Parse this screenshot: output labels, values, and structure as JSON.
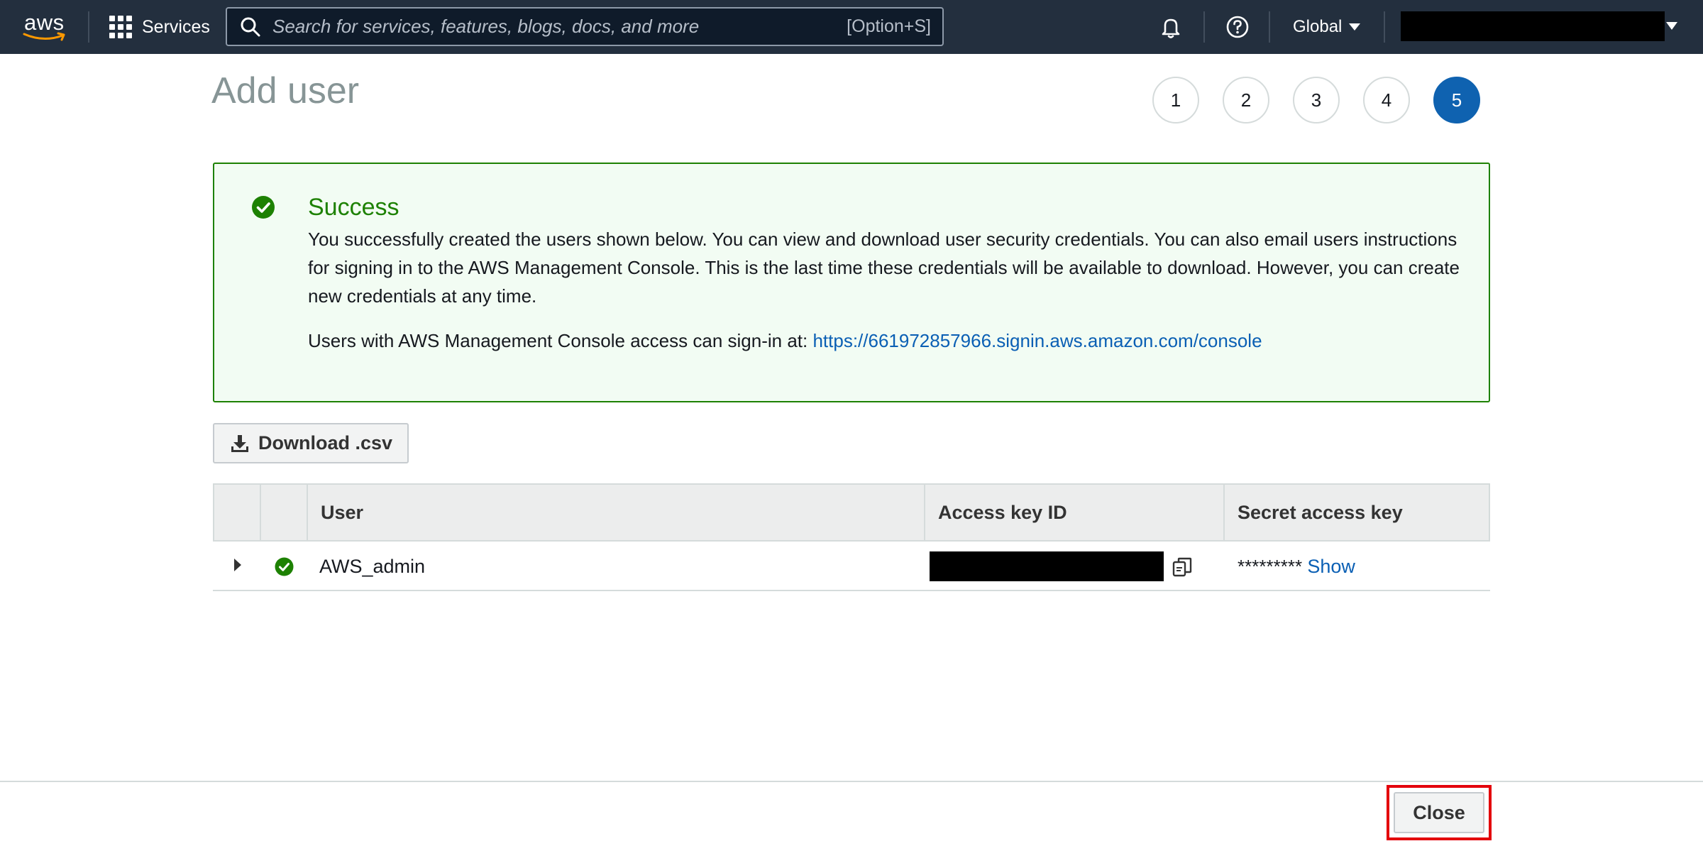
{
  "topnav": {
    "logo_text": "aws",
    "services_label": "Services",
    "search_placeholder": "Search for services, features, blogs, docs, and more",
    "search_shortcut": "[Option+S]",
    "region_label": "Global"
  },
  "page": {
    "title": "Add user",
    "steps": [
      "1",
      "2",
      "3",
      "4",
      "5"
    ],
    "active_step": "5"
  },
  "alert": {
    "title": "Success",
    "body": "You successfully created the users shown below. You can view and download user security credentials. You can also email users instructions for signing in to the AWS Management Console. This is the last time these credentials will be available to download. However, you can create new credentials at any time.",
    "signin_prefix": "Users with AWS Management Console access can sign-in at: ",
    "signin_url": "https://661972857966.signin.aws.amazon.com/console"
  },
  "download": {
    "label": "Download .csv"
  },
  "table": {
    "headers": [
      "User",
      "Access key ID",
      "Secret access key"
    ],
    "rows": [
      {
        "user": "AWS_admin",
        "secret_masked": "*********",
        "show_label": "Show"
      }
    ]
  },
  "footer": {
    "close_label": "Close"
  },
  "colors": {
    "nav_bg": "#232f3e",
    "success": "#1d8102",
    "link": "#0a5fb4",
    "active_step": "#0f62b0",
    "highlight": "#e3000b"
  }
}
